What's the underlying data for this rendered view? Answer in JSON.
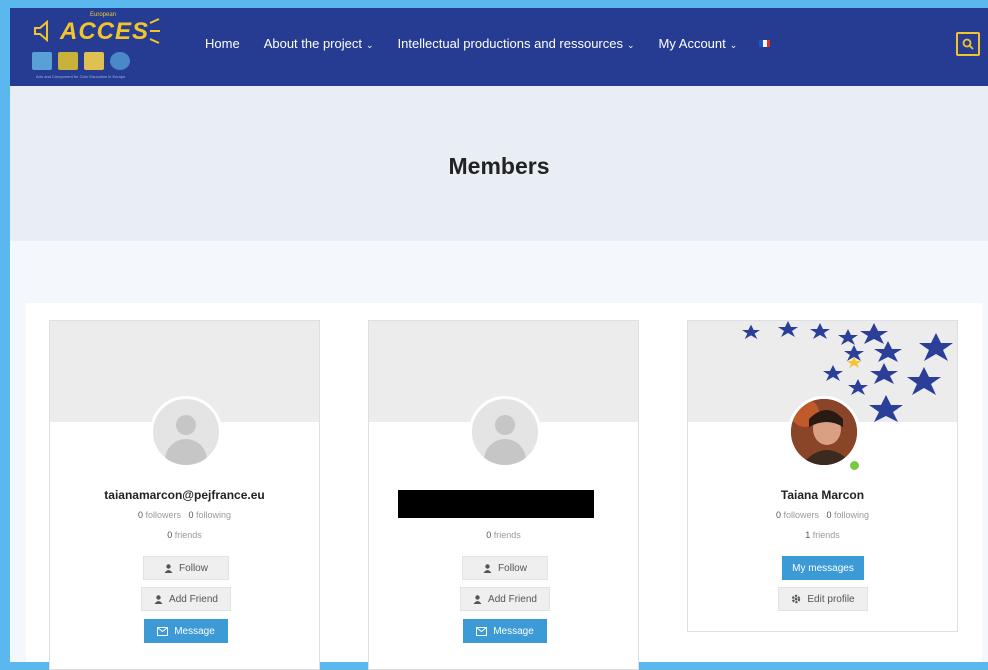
{
  "brand": {
    "eu_label": "European",
    "name": "ACCES",
    "tagline": "Arts and Component for Civic Education in Europe"
  },
  "nav": {
    "items": [
      {
        "label": "Home",
        "dropdown": false
      },
      {
        "label": "About the project",
        "dropdown": true
      },
      {
        "label": "Intellectual productions and ressources",
        "dropdown": true
      },
      {
        "label": "My Account",
        "dropdown": true
      }
    ],
    "language_flag": "french-flag-icon",
    "search_icon": "search-icon"
  },
  "page": {
    "title": "Members"
  },
  "members": [
    {
      "name": "taianamarcon@pejfrance.eu",
      "followers_count": "0",
      "followers_label": "followers",
      "following_count": "0",
      "following_label": "following",
      "friends_count": "0",
      "friends_label": "friends",
      "btn1": "Follow",
      "btn2": "Add Friend",
      "btn3": "Message"
    },
    {
      "name": "",
      "followers_count": "",
      "followers_label": "",
      "following_count": "",
      "following_label": "",
      "friends_count": "0",
      "friends_label": "friends",
      "btn1": "Follow",
      "btn2": "Add Friend",
      "btn3": "Message"
    },
    {
      "name": "Taiana Marcon",
      "followers_count": "0",
      "followers_label": "followers",
      "following_count": "0",
      "following_label": "following",
      "friends_count": "1",
      "friends_label": "friends",
      "btn1": "My messages",
      "btn2": "Edit profile",
      "online": true
    }
  ],
  "colors": {
    "navbar": "#263c93",
    "brand_yellow": "#f4c52b",
    "button_blue": "#3c9ad6",
    "online_green": "#7ac943",
    "eu_star_blue": "#2b3f99"
  }
}
